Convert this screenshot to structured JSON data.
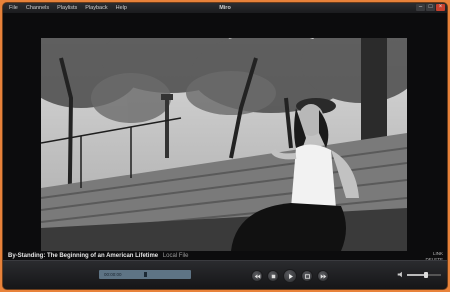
{
  "app": {
    "title": "Miro"
  },
  "menu": [
    "File",
    "Channels",
    "Playlists",
    "Playback",
    "Help"
  ],
  "window_controls": {
    "minimize": "–",
    "maximize": "□",
    "close": "×"
  },
  "video": {
    "title": "By-Standing: The Beginning of an American Lifetime",
    "source": "Local File"
  },
  "side_links": {
    "top": "LINK",
    "bottom": "DELETE"
  },
  "playback": {
    "time": "00:00:00",
    "progress": 0.5,
    "volume": 0.55
  },
  "icons": {
    "prev": "skip-back-icon",
    "stop": "stop-icon",
    "play": "play-icon",
    "fullscreen": "fullscreen-icon",
    "next": "skip-forward-icon",
    "volume": "speaker-icon"
  },
  "colors": {
    "desktop": "#e8823a",
    "window": "#141416",
    "seek_bar": "#5e7485",
    "close_button": "#c8412e"
  }
}
